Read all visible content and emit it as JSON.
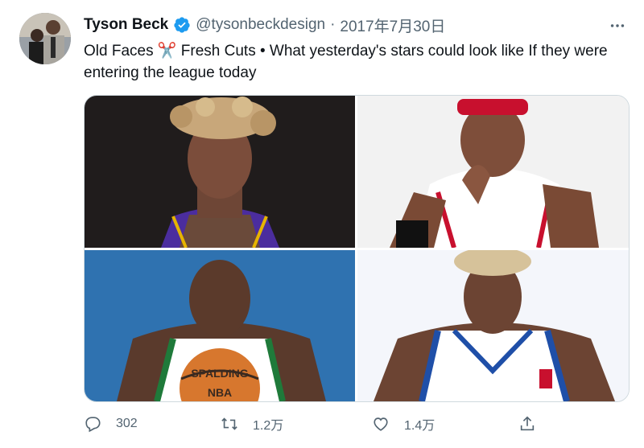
{
  "tweet": {
    "author_name": "Tyson Beck",
    "handle": "@tysonbeckdesign",
    "separator": "·",
    "date": "2017年7月30日",
    "text": "Old Faces ✂️ Fresh Cuts • What yesterday's stars could look like If they were entering the league today",
    "verified_color": "#1d9bf0"
  },
  "actions": {
    "replies": "302",
    "retweets": "1.2万",
    "likes": "1.4万"
  },
  "icons": {
    "more": "more-dots-icon",
    "reply": "reply-icon",
    "retweet": "retweet-icon",
    "like": "heart-icon",
    "share": "share-icon"
  },
  "media": {
    "photos": [
      {
        "label": "Kobe-style portrait, purple jersey"
      },
      {
        "label": "Iverson-style portrait, 76ers jersey"
      },
      {
        "label": "Garnett-style portrait with basketball"
      },
      {
        "label": "McGrady-style portrait, white jersey"
      }
    ]
  },
  "image_texts": {
    "ball_brand": "SPALDING",
    "ball_logo": "NBA"
  }
}
